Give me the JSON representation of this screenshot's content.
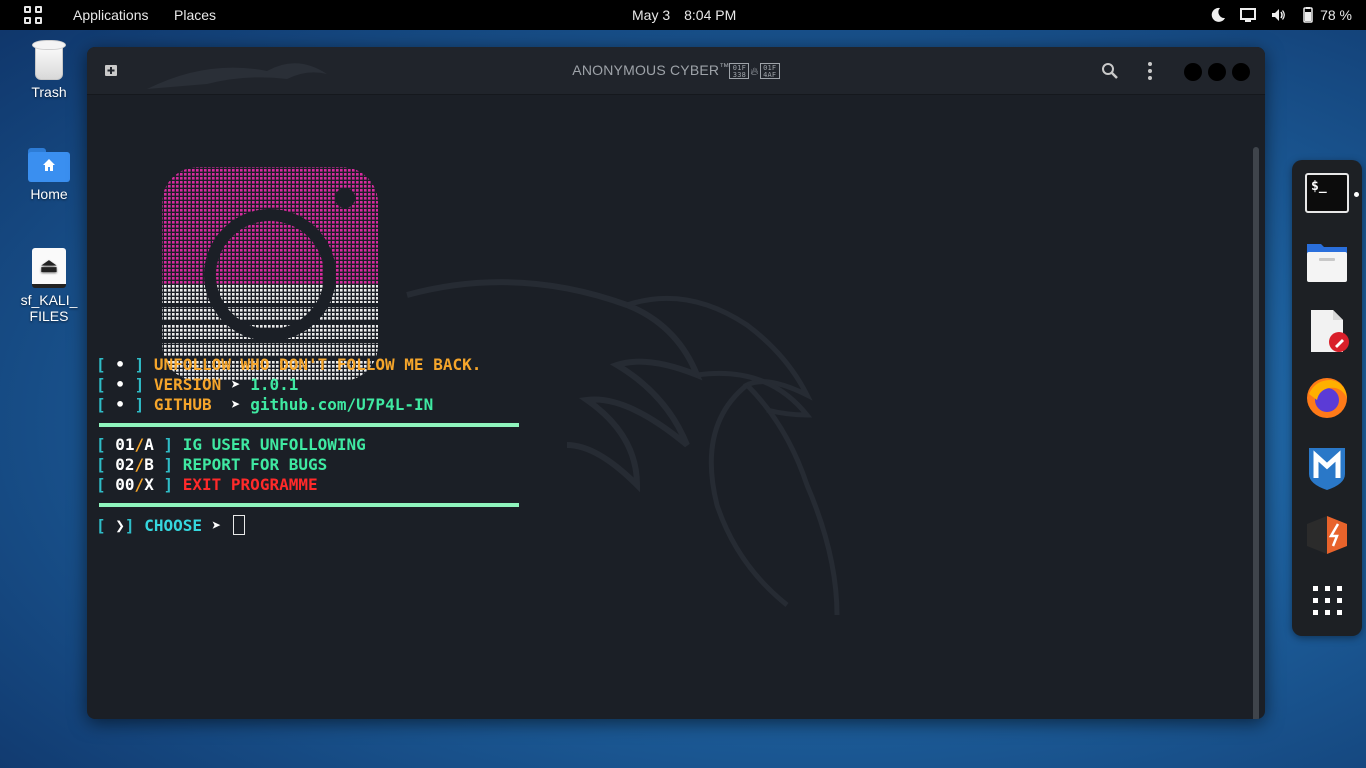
{
  "topbar": {
    "applications": "Applications",
    "places": "Places",
    "date": "May 3",
    "time": "8:04 PM",
    "battery": "78 %"
  },
  "desktop": {
    "trash": "Trash",
    "home": "Home",
    "drive_line1": "sf_KALI_",
    "drive_line2": "FILES"
  },
  "window": {
    "title": "ANONYMOUS CYBER",
    "trademark": "™",
    "glyph1_top": "01F",
    "glyph1_bottom": "338",
    "glyph2_top": "01F",
    "glyph2_bottom": "4AF"
  },
  "terminal": {
    "bracket_open": "[",
    "bracket_close": "]",
    "bullet": "•",
    "arrow": "➤",
    "info": [
      {
        "label": "UNFOLLOW WHO DON'T FOLLOW ME BACK.",
        "value": ""
      },
      {
        "label": "VERSION",
        "value": "1.0.1"
      },
      {
        "label": "GITHUB ",
        "value": "github.com/U7P4L-IN"
      }
    ],
    "options": [
      {
        "num": "01",
        "letter": "A",
        "label": "IG USER UNFOLLOWING"
      },
      {
        "num": "02",
        "letter": "B",
        "label": "REPORT FOR BUGS"
      },
      {
        "num": "00",
        "letter": "X",
        "label": "EXIT PROGRAMME"
      }
    ],
    "prompt_symbol": "❯",
    "prompt_label": "CHOOSE"
  },
  "dock": {
    "terminal_label": "$_"
  },
  "colors": {
    "accent_orange": "#f5a52b",
    "accent_green": "#3fe9a2",
    "accent_red": "#ff2a2a",
    "accent_cyan": "#35d7de",
    "logo_pink": "#d62b9e"
  }
}
